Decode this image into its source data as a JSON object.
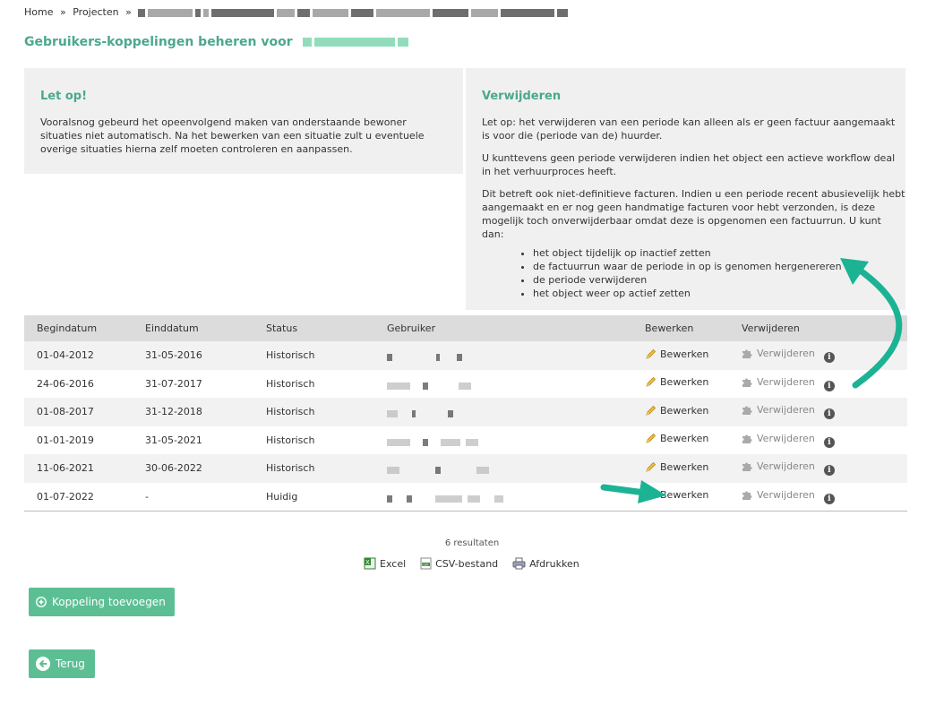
{
  "breadcrumb": {
    "home": "Home",
    "sep1": "»",
    "projects": "Projecten",
    "sep2": "»"
  },
  "title": "Gebruikers-koppelingen beheren voor",
  "notice": {
    "heading": "Let op!",
    "text": "Vooralsnog gebeurd het opeenvolgend maken van onderstaande bewoner situaties niet automatisch. Na het bewerken van een situatie zult u eventuele overige situaties hierna zelf moeten controleren en aanpassen."
  },
  "remove_info": {
    "heading": "Verwijderen",
    "p1": "Let op: het verwijderen van een periode kan alleen als er geen factuur aangemaakt is voor die (periode van de) huurder.",
    "p2": "U kunttevens geen periode verwijderen indien het object een actieve workflow deal in het verhuurproces heeft.",
    "p3": "Dit betreft ook niet-definitieve facturen. Indien u een periode recent abusievelijk hebt aangemaakt en er nog geen handmatige facturen voor hebt verzonden, is deze mogelijk toch onverwijderbaar omdat deze is opgenomen een factuurrun. U kunt dan:",
    "steps": [
      "het object tijdelijk op inactief zetten",
      "de factuurrun waar de periode in op is genomen hergenereren",
      "de periode verwijderen",
      "het object weer op actief zetten"
    ]
  },
  "table": {
    "headers": [
      "Begindatum",
      "Einddatum",
      "Status",
      "Gebruiker",
      "Bewerken",
      "Verwijderen"
    ],
    "rows": [
      {
        "start": "01-04-2012",
        "end": "31-05-2016",
        "status": "Historisch",
        "edit": "Bewerken",
        "delete": "Verwijderen"
      },
      {
        "start": "24-06-2016",
        "end": "31-07-2017",
        "status": "Historisch",
        "edit": "Bewerken",
        "delete": "Verwijderen"
      },
      {
        "start": "01-08-2017",
        "end": "31-12-2018",
        "status": "Historisch",
        "edit": "Bewerken",
        "delete": "Verwijderen"
      },
      {
        "start": "01-01-2019",
        "end": "31-05-2021",
        "status": "Historisch",
        "edit": "Bewerken",
        "delete": "Verwijderen"
      },
      {
        "start": "11-06-2021",
        "end": "30-06-2022",
        "status": "Historisch",
        "edit": "Bewerken",
        "delete": "Verwijderen"
      },
      {
        "start": "01-07-2022",
        "end": "-",
        "status": "Huidig",
        "edit": "Bewerken",
        "delete": "Verwijderen"
      }
    ]
  },
  "results": "6 resultaten",
  "exports": {
    "excel": "Excel",
    "csv": "CSV-bestand",
    "print": "Afdrukken"
  },
  "buttons": {
    "add": "Koppeling toevoegen",
    "back": "Terug"
  },
  "colors": {
    "accent": "#4aa88e",
    "button": "#5cbf94",
    "arrow": "#1bb394"
  }
}
